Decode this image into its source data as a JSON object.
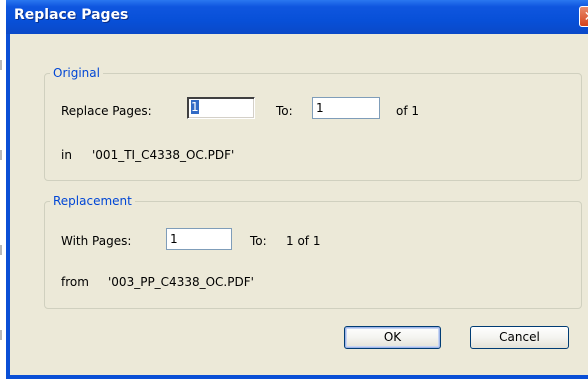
{
  "window": {
    "title": "Replace Pages",
    "close_glyph": "✕"
  },
  "original": {
    "legend": "Original",
    "replace_pages_label": "Replace Pages:",
    "replace_pages_value": "1",
    "to_label": "To:",
    "to_value": "1",
    "of_text": "of 1",
    "in_label": "in",
    "in_file": "'001_TI_C4338_OC.PDF'"
  },
  "replacement": {
    "legend": "Replacement",
    "with_pages_label": "With Pages:",
    "with_pages_value": "1",
    "to_label": "To:",
    "to_text": "1 of 1",
    "from_label": "from",
    "from_file": "'003_PP_C4338_OC.PDF'"
  },
  "buttons": {
    "ok": "OK",
    "cancel": "Cancel"
  },
  "colors": {
    "titlebar": "#0850d8",
    "dialog_bg": "#ece9d8",
    "legend_text": "#0046d5",
    "close_button": "#d6431c"
  }
}
